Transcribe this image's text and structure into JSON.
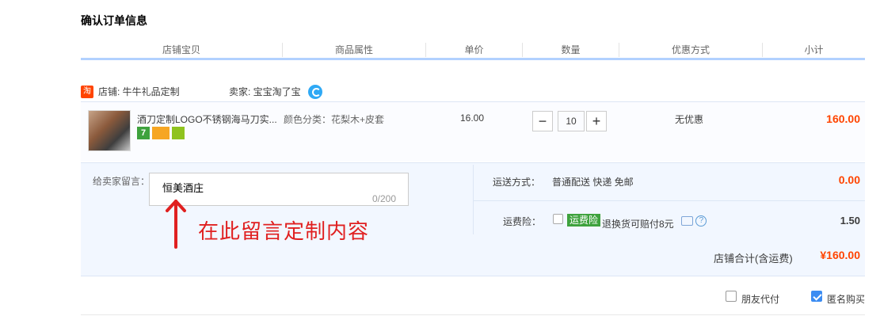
{
  "section_title": "确认订单信息",
  "columns": [
    "店铺宝贝",
    "商品属性",
    "单价",
    "数量",
    "优惠方式",
    "小计"
  ],
  "shop": {
    "logo_text": "淘",
    "shop_label": "店铺: 牛牛礼品定制",
    "seller_label": "卖家: 宝宝淘了宝"
  },
  "item": {
    "name": "酒刀定制LOGO不锈钢海马刀实...",
    "badges": [
      "7",
      "",
      ""
    ],
    "attributes": "颜色分类：花梨木+皮套",
    "unit_price": "16.00",
    "quantity": "10",
    "minus": "−",
    "plus": "+",
    "discount": "无优惠",
    "subtotal": "160.00"
  },
  "message": {
    "label": "给卖家留言：",
    "value": "恒美酒庄",
    "counter": "0/200"
  },
  "annotation": "在此留言定制内容",
  "shipping": {
    "label": "运送方式：",
    "value": "普通配送 快递 免邮",
    "cost": "0.00"
  },
  "insurance": {
    "label": "运费险：",
    "tag": "运费险",
    "description": "退换货可赔付8元",
    "help": "?",
    "cost": "1.50",
    "checked": false
  },
  "total": {
    "label": "店铺合计(含运费)",
    "value": "¥160.00"
  },
  "options": [
    {
      "label": "朋友代付",
      "checked": false
    },
    {
      "label": "匿名购买",
      "checked": true
    }
  ],
  "colors": {
    "accent": "#ff4400",
    "header_line": "#b2d1ff",
    "annotation": "#e02020",
    "checkbox_checked": "#3b8cf2"
  }
}
